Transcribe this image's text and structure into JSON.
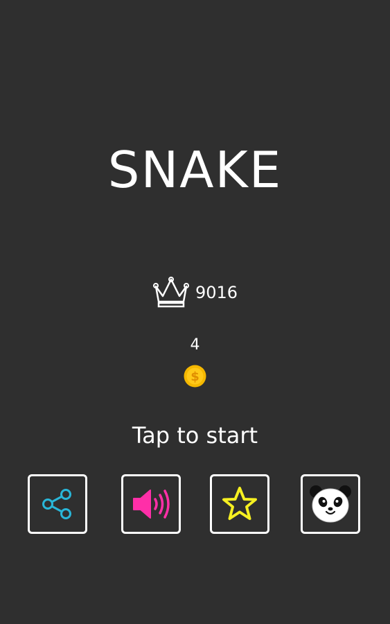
{
  "title": "SNAKE",
  "best_score": "9016",
  "coins": "4",
  "coin_symbol": "$",
  "start_prompt": "Tap to start",
  "icons": {
    "best": "crown-icon",
    "coin": "coin-icon",
    "share": "share-icon",
    "sound": "speaker-icon",
    "rate": "star-icon",
    "skin": "panda-icon"
  },
  "colors": {
    "background": "#2f2f2f",
    "text": "#ffffff",
    "share": "#29b6d8",
    "sound": "#ff2fa8",
    "rate": "#f6f021",
    "coin": "#f5b800"
  }
}
